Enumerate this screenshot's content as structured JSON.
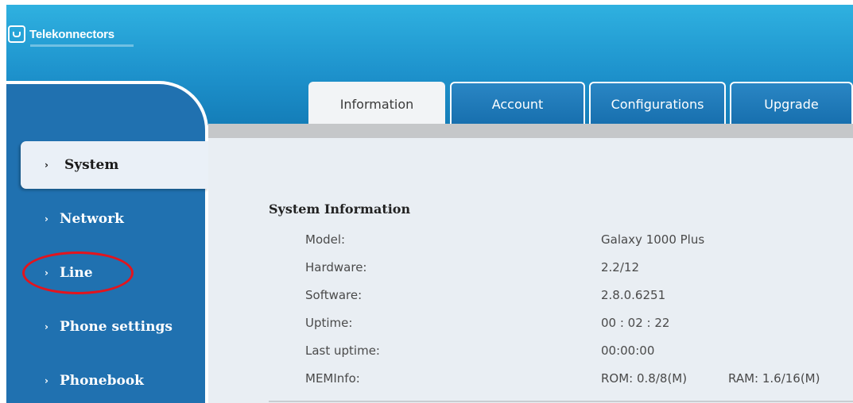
{
  "brand": {
    "name": "Telekonnectors"
  },
  "sidebar": {
    "items": [
      {
        "label": "System",
        "active": true
      },
      {
        "label": "Network"
      },
      {
        "label": "Line",
        "highlighted": true
      },
      {
        "label": "Phone settings"
      },
      {
        "label": "Phonebook"
      }
    ],
    "chevron": "›"
  },
  "tabs": [
    {
      "label": "Information",
      "active": true
    },
    {
      "label": "Account"
    },
    {
      "label": "Configurations"
    },
    {
      "label": "Upgrade"
    }
  ],
  "system_info": {
    "title": "System Information",
    "rows": [
      {
        "label": "Model:",
        "value": "Galaxy 1000 Plus"
      },
      {
        "label": "Hardware:",
        "value": "2.2/12"
      },
      {
        "label": "Software:",
        "value": "2.8.0.6251"
      },
      {
        "label": "Uptime:",
        "value": "00 : 02 : 22"
      },
      {
        "label": "Last uptime:",
        "value": "00:00:00"
      },
      {
        "label": "MEMInfo:",
        "value": "ROM: 0.8/8(M)",
        "value2": "RAM: 1.6/16(M)"
      }
    ]
  },
  "colors": {
    "header_top": "#2fb1e0",
    "sidebar": "#2071b0",
    "tab_inactive": "#176fae",
    "content_bg": "#e9eef3",
    "highlight_oval": "#e3141d"
  }
}
